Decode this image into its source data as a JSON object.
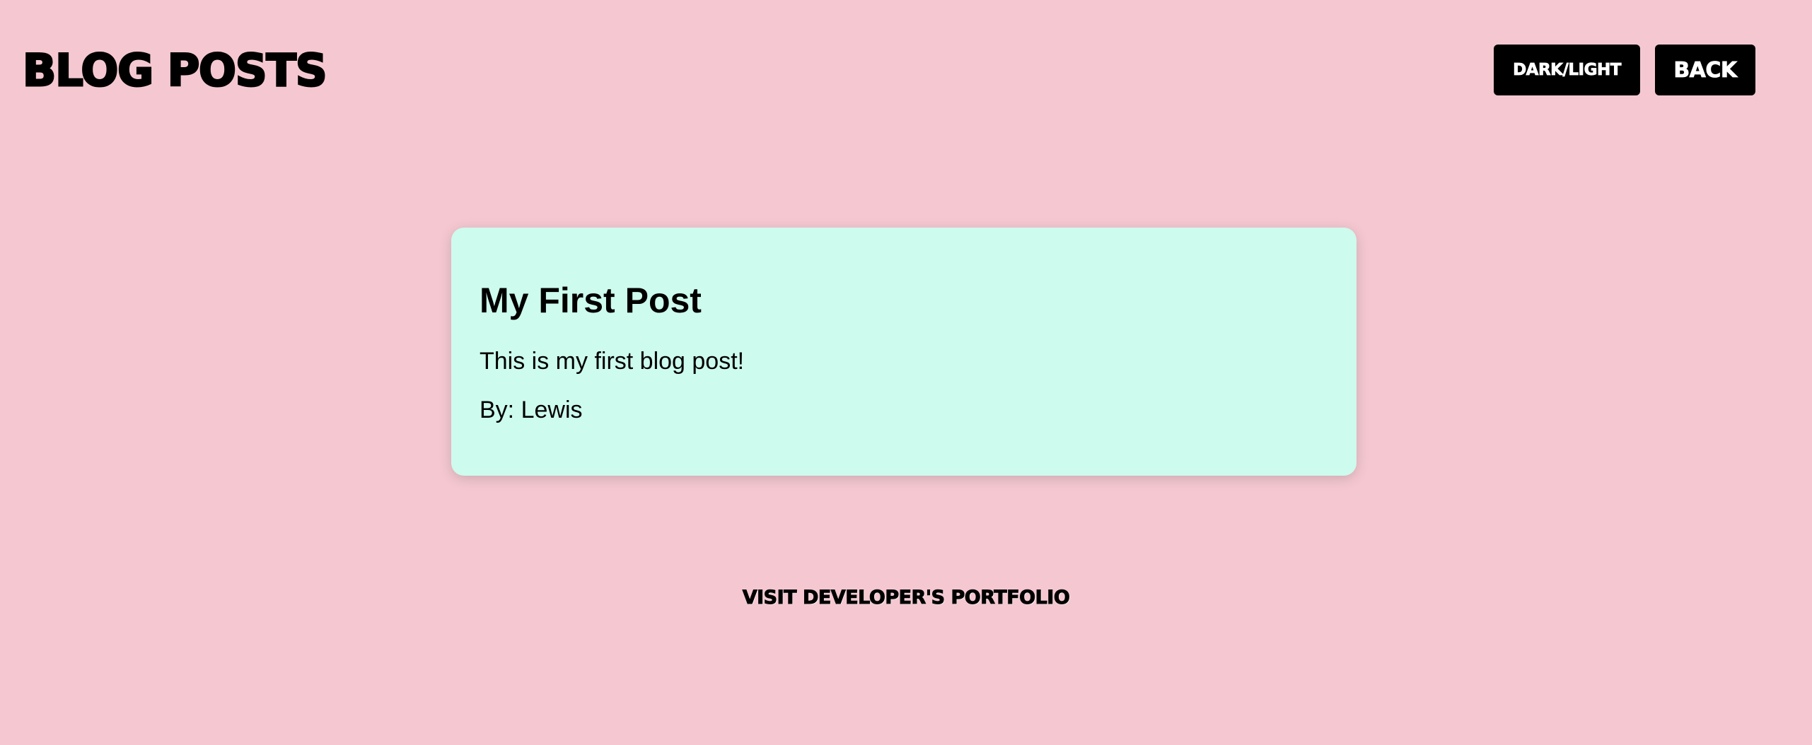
{
  "header": {
    "title": "BLOG POSTS",
    "theme_toggle_label": "DARK/LIGHT",
    "back_label": "BACK"
  },
  "posts": [
    {
      "title": "My First Post",
      "body": "This is my first blog post!",
      "author": "By: Lewis"
    }
  ],
  "footer": {
    "portfolio_link_label": "VISIT DEVELOPER'S PORTFOLIO"
  },
  "colors": {
    "background": "#f5c8d1",
    "card": "#cdfbed",
    "button": "#000000",
    "button_text": "#ffffff"
  }
}
